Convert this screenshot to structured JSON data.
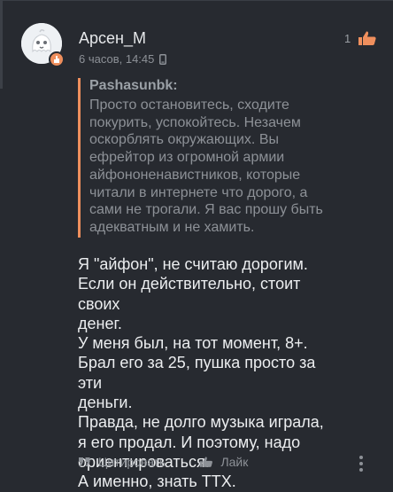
{
  "post": {
    "author": "Арсен_М",
    "time": "6 часов, 14:45",
    "like_count": "1",
    "avatar": {
      "icon": "cartoon-ghost-avatar",
      "badge_icon": "hand-icon",
      "badge_color": "#ef8f5d"
    },
    "quote": {
      "author": "Pashasunbk:",
      "lines": [
        "Просто остановитесь, сходите",
        "покурить, успокойтесь. Незачем",
        "оскорблять окружающих. Вы",
        "ефрейтор из огромной армии",
        "айфононенавистников, которые",
        "читали в интернете что дорого, а",
        "сами не трогали. Я вас прошу быть",
        "адекватным и не хамить."
      ]
    },
    "body_lines": [
      "Я \"айфон\", не считаю дорогим.",
      "Если он действительно, стоит своих",
      "денег.",
      "У меня был, на тот момент, 8+.",
      "Брал его за 25, пушка просто за эти",
      "деньги.",
      "Правда, не долго музыка играла,",
      "я его продал. И поэтому, надо",
      "ориентироваться.",
      "А именно, знать ТТХ."
    ]
  },
  "actions": {
    "quote_label": "Цитировать",
    "like_label": "Лайк"
  },
  "colors": {
    "background": "#272a30",
    "accent": "#ef8f5d",
    "text": "#eceef0",
    "muted": "#8d9197"
  }
}
